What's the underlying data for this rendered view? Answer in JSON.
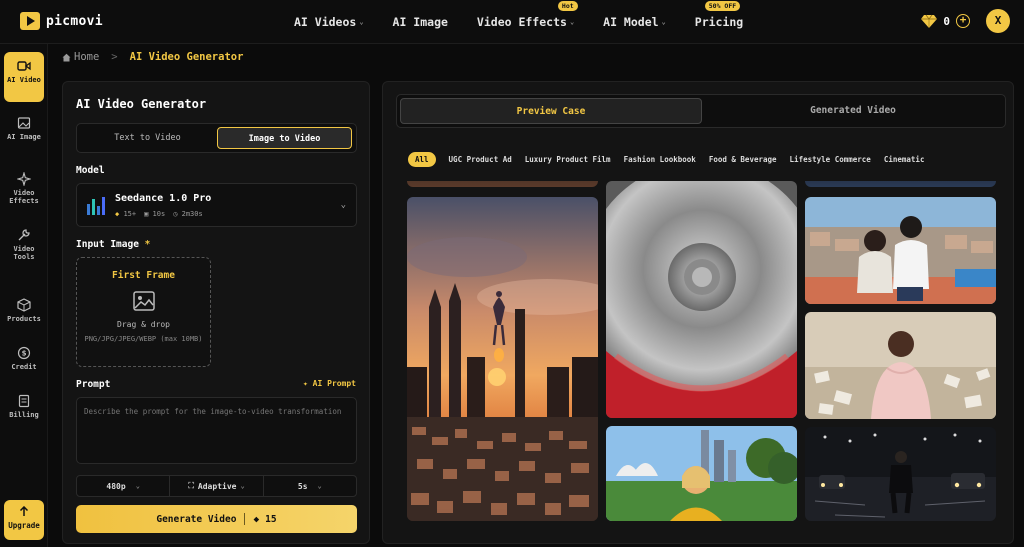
{
  "brand": {
    "name": "picmovi"
  },
  "nav": {
    "items": [
      {
        "label": "AI Videos",
        "chevron": true
      },
      {
        "label": "AI Image",
        "chevron": false
      },
      {
        "label": "Video Effects",
        "chevron": true,
        "badge": "Hot"
      },
      {
        "label": "AI Model",
        "chevron": true
      },
      {
        "label": "Pricing",
        "chevron": false,
        "badge": "50% OFF"
      }
    ],
    "credits": "0",
    "avatar_initial": "X"
  },
  "sidebar": {
    "items": [
      {
        "label": "AI Video",
        "icon": "video-icon",
        "active": true
      },
      {
        "label": "AI Image",
        "icon": "image-icon"
      },
      {
        "label": "Video Effects",
        "icon": "sparkle-icon"
      },
      {
        "label": "Video Tools",
        "icon": "wrench-icon"
      },
      {
        "label": "Products",
        "icon": "box-icon"
      },
      {
        "label": "Credit",
        "icon": "coin-icon"
      },
      {
        "label": "Billing",
        "icon": "receipt-icon"
      }
    ],
    "upgrade": "Upgrade"
  },
  "breadcrumb": {
    "home": "Home",
    "separator": ">",
    "current": "AI Video Generator"
  },
  "generator": {
    "title": "AI Video Generator",
    "modes": [
      "Text to Video",
      "Image to Video"
    ],
    "active_mode": 1,
    "model_label": "Model",
    "model": {
      "name": "Seedance 1.0 Pro",
      "cost": "15+",
      "duration": "10s",
      "time": "2m30s"
    },
    "input_image_label": "Input Image",
    "required_mark": "*",
    "upload": {
      "title": "First Frame",
      "drag_text": "Drag & drop",
      "formats": "PNG/JPG/JPEG/WEBP (max 10MB)"
    },
    "prompt_label": "Prompt",
    "ai_prompt": "AI Prompt",
    "prompt_placeholder": "Describe the prompt for the image-to-video transformation",
    "options": {
      "resolution": "480p",
      "ratio": "Adaptive",
      "duration": "5s"
    },
    "generate_label": "Generate Video",
    "generate_cost": "15"
  },
  "preview": {
    "tabs": [
      "Preview Case",
      "Generated Video"
    ],
    "active_tab": 0,
    "categories": [
      "All",
      "UGC Product Ad",
      "Luxury Product Film",
      "Fashion Lookbook",
      "Food & Beverage",
      "Lifestyle Commerce",
      "Cinematic"
    ],
    "active_category": 0
  },
  "colors": {
    "accent": "#f2c744",
    "background": "#0b0b0b",
    "panel": "#141414"
  }
}
